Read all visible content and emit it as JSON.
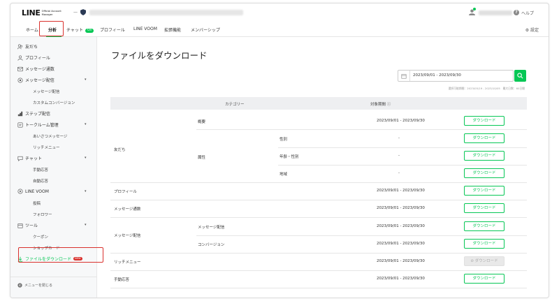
{
  "topbar": {
    "logo_main": "LINE",
    "logo_sub": "Official Account Manager",
    "account_separator": "—",
    "help_label": "ヘルプ"
  },
  "nav": {
    "items": [
      "ホーム",
      "分析",
      "チャット",
      "プロフィール",
      "LINE VOOM",
      "拡張機能",
      "メンバーシップ"
    ],
    "chat_badge": "On",
    "settings_label": "設定",
    "active": "分析"
  },
  "sidebar": {
    "items": [
      {
        "label": "友だち",
        "icon": "friends-icon"
      },
      {
        "label": "プロフィール",
        "icon": "profile-icon"
      },
      {
        "label": "メッセージ通数",
        "icon": "message-count-icon"
      },
      {
        "label": "メッセージ配信",
        "icon": "message-delivery-icon",
        "expandable": true
      },
      {
        "label": "メッセージ配信",
        "sub": true
      },
      {
        "label": "カスタムコンバージョン",
        "sub": true
      },
      {
        "label": "ステップ配信",
        "icon": "step-icon"
      },
      {
        "label": "トークルーム管理",
        "icon": "talkroom-icon",
        "expandable": true
      },
      {
        "label": "あいさつメッセージ",
        "sub": true
      },
      {
        "label": "リッチメニュー",
        "sub": true
      },
      {
        "label": "チャット",
        "icon": "chat-icon",
        "expandable": true
      },
      {
        "label": "手動応答",
        "sub": true
      },
      {
        "label": "自動応答",
        "sub": true
      },
      {
        "label": "LINE VOOM",
        "icon": "voom-icon",
        "expandable": true
      },
      {
        "label": "投稿",
        "sub": true
      },
      {
        "label": "フォロワー",
        "sub": true
      },
      {
        "label": "ツール",
        "icon": "tool-icon",
        "expandable": true
      },
      {
        "label": "クーポン",
        "sub": true
      },
      {
        "label": "ショップカード",
        "sub": true
      },
      {
        "label": "ファイルをダウンロード",
        "icon": "download-icon",
        "badge": "NEW"
      }
    ],
    "close_label": "メニューを閉じる"
  },
  "main": {
    "title": "ファイルをダウンロード",
    "date_range": "2023/09/01 - 2023/09/30",
    "date_note": "選択可能期間：2023/05/19 - 2023/10/05　最大日数：60日間",
    "headers": {
      "category": "カテゴリー",
      "period": "対象期間"
    },
    "download_label": "ダウンロード",
    "rows": [
      {
        "col1": "友だち",
        "col2": "概要",
        "col3": "",
        "period": "2023/09/01 - 2023/09/30",
        "enabled": true
      },
      {
        "col1": "",
        "col2": "属性",
        "col3": "性別",
        "period": "-",
        "enabled": true
      },
      {
        "col1": "",
        "col2": "",
        "col3": "年齢・性別",
        "period": "-",
        "enabled": true
      },
      {
        "col1": "",
        "col2": "",
        "col3": "地域",
        "period": "-",
        "enabled": true
      },
      {
        "col1": "プロフィール",
        "col2": "",
        "col3": "",
        "period": "2023/09/01 - 2023/09/30",
        "enabled": true
      },
      {
        "col1": "メッセージ通数",
        "col2": "",
        "col3": "",
        "period": "2023/09/01 - 2023/09/30",
        "enabled": true
      },
      {
        "col1": "メッセージ配信",
        "col2": "メッセージ配信",
        "col3": "",
        "period": "2023/09/01 - 2023/09/30",
        "enabled": true
      },
      {
        "col1": "",
        "col2": "コンバージョン",
        "col3": "",
        "period": "2023/09/01 - 2023/09/30",
        "enabled": true
      },
      {
        "col1": "リッチメニュー",
        "col2": "",
        "col3": "",
        "period": "2023/09/01 - 2023/09/30",
        "enabled": false
      },
      {
        "col1": "手動応答",
        "col2": "",
        "col3": "",
        "period": "2023/09/01 - 2023/09/30",
        "enabled": true
      }
    ]
  },
  "colors": {
    "accent": "#06c755",
    "highlight": "#d9302c"
  }
}
